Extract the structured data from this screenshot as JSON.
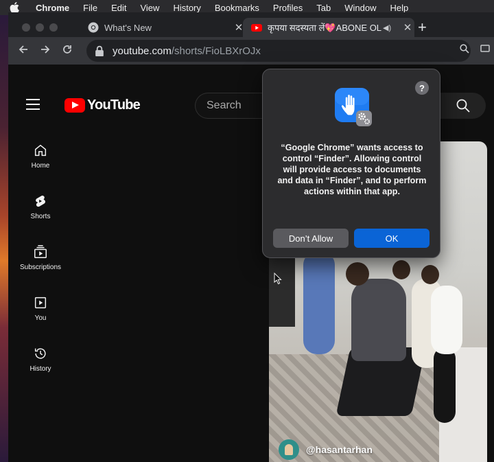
{
  "menubar": {
    "app": "Chrome",
    "items": [
      "File",
      "Edit",
      "View",
      "History",
      "Bookmarks",
      "Profiles",
      "Tab",
      "Window",
      "Help"
    ]
  },
  "tabs": [
    {
      "title": "What's New",
      "close": "✕"
    },
    {
      "title": "कृपया सदस्यता लें💖ABONE OL",
      "close": "✕"
    }
  ],
  "new_tab": "+",
  "address": {
    "host": "youtube.com",
    "path": "/shorts/FioLBXrOJx"
  },
  "youtube": {
    "logo": "YouTube",
    "search_placeholder": "Search",
    "nav": [
      {
        "label": "Home",
        "icon": "home-icon"
      },
      {
        "label": "Shorts",
        "icon": "shorts-icon"
      },
      {
        "label": "Subscriptions",
        "icon": "subscriptions-icon"
      },
      {
        "label": "You",
        "icon": "you-icon"
      },
      {
        "label": "History",
        "icon": "history-icon"
      }
    ],
    "channel": "@hasantarhan"
  },
  "dialog": {
    "help": "?",
    "message": "“Google Chrome” wants access to control “Finder”. Allowing control will provide access to documents and data in “Finder”, and to perform actions within that app.",
    "deny_label": "Don’t Allow",
    "ok_label": "OK",
    "accent": "#0a64d6"
  }
}
